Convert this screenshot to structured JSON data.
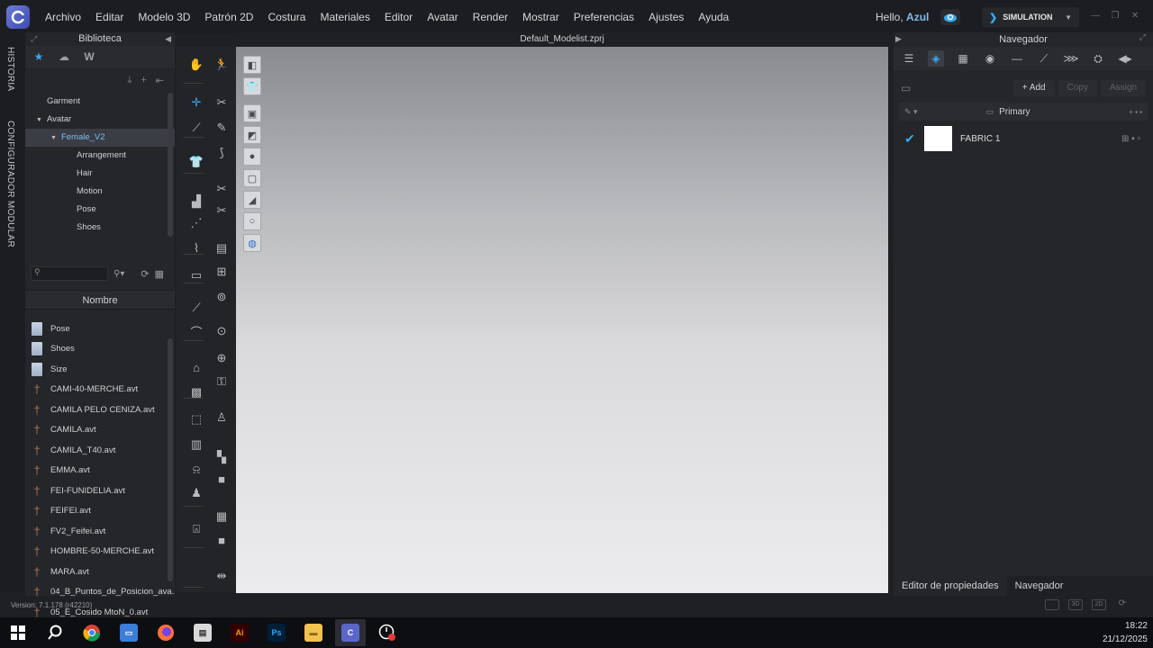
{
  "menubar": {
    "items": [
      "Archivo",
      "Editar",
      "Modelo 3D",
      "Patrón 2D",
      "Costura",
      "Materiales",
      "Editor",
      "Avatar",
      "Render",
      "Mostrar",
      "Preferencias",
      "Ajustes",
      "Ayuda"
    ],
    "hello_prefix": "Hello,",
    "hello_user": "Azul",
    "mode": "SIMULATION"
  },
  "vertical_tabs": [
    "HISTORIA",
    "CONFIGURADOR MODULAR"
  ],
  "library": {
    "title": "Biblioteca",
    "tree": [
      {
        "label": "Garment",
        "level": 0,
        "expanded": null
      },
      {
        "label": "Avatar",
        "level": 0,
        "expanded": true
      },
      {
        "label": "Female_V2",
        "level": 1,
        "expanded": true,
        "selected": true
      },
      {
        "label": "Arrangement",
        "level": 2
      },
      {
        "label": "Hair",
        "level": 2
      },
      {
        "label": "Motion",
        "level": 2
      },
      {
        "label": "Pose",
        "level": 2
      },
      {
        "label": "Shoes",
        "level": 2
      }
    ],
    "column_header": "Nombre",
    "files": [
      {
        "name": "Pose",
        "kind": "folder"
      },
      {
        "name": "Shoes",
        "kind": "folder"
      },
      {
        "name": "Size",
        "kind": "folder"
      },
      {
        "name": "CAMI-40-MERCHE.avt",
        "kind": "avatar"
      },
      {
        "name": "CAMILA PELO CENIZA.avt",
        "kind": "avatar"
      },
      {
        "name": "CAMILA.avt",
        "kind": "avatar"
      },
      {
        "name": "CAMILA_T40.avt",
        "kind": "avatar"
      },
      {
        "name": "EMMA.avt",
        "kind": "avatar"
      },
      {
        "name": "FEI-FUNIDELIA.avt",
        "kind": "avatar"
      },
      {
        "name": "FEIFEI.avt",
        "kind": "avatar"
      },
      {
        "name": "FV2_Feifei.avt",
        "kind": "avatar"
      },
      {
        "name": "HOMBRE-50-MERCHE.avt",
        "kind": "avatar"
      },
      {
        "name": "MARA.avt",
        "kind": "avatar"
      },
      {
        "name": "04_B_Puntos_de_Posicion_ava...",
        "kind": "avatar"
      },
      {
        "name": "05_E_Cosido MtoN_0.avt",
        "kind": "avatar"
      }
    ],
    "version": "Version: 7.1.178 (r42210)"
  },
  "viewport": {
    "title": "Default_Modelist.zprj"
  },
  "navigator": {
    "title": "Navegador",
    "add_label": "Add",
    "copy_label": "Copy",
    "assign_label": "Assign",
    "group_label": "Primary",
    "fabrics": [
      {
        "name": "FABRIC 1",
        "color": "#ffffff"
      }
    ],
    "bottom_tabs": [
      "Editor de propiedades",
      "Navegador"
    ]
  },
  "taskbar": {
    "time": "18:22",
    "date": "21/12/2025"
  },
  "colors": {
    "accent": "#3aa8f0",
    "selection_text": "#7fbcf0"
  }
}
